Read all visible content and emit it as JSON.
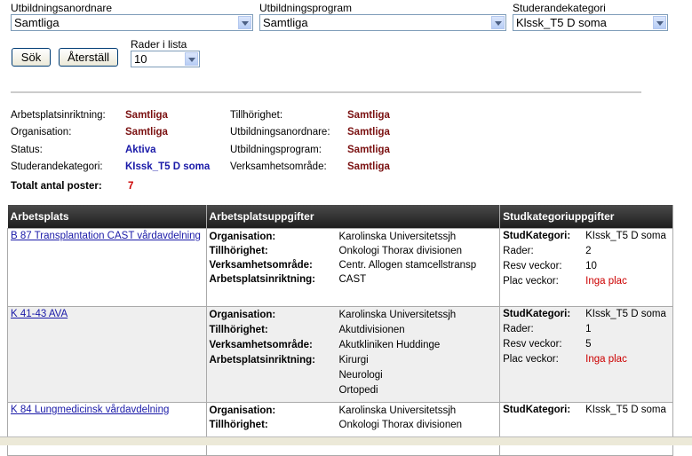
{
  "filters": {
    "utbildningsanordnare": {
      "label": "Utbildningsanordnare",
      "value": "Samtliga"
    },
    "utbildningsprogram": {
      "label": "Utbildningsprogram",
      "value": "Samtliga"
    },
    "studerandekategori": {
      "label": "Studerandekategori",
      "value": "Klssk_T5 D soma"
    },
    "rader": {
      "label": "Rader i lista",
      "value": "10"
    }
  },
  "buttons": {
    "search": "Sök",
    "reset": "Återställ"
  },
  "summary": {
    "left": [
      {
        "label": "Arbetsplatsinriktning:",
        "value": "Samtliga"
      },
      {
        "label": "Organisation:",
        "value": "Samtliga"
      },
      {
        "label": "Status:",
        "value": "Aktiva"
      },
      {
        "label": "Studerandekategori:",
        "value": "KIssk_T5 D soma"
      }
    ],
    "right": [
      {
        "label": "Tillhörighet:",
        "value": "Samtliga"
      },
      {
        "label": "Utbildningsanordnare:",
        "value": "Samtliga"
      },
      {
        "label": "Utbildningsprogram:",
        "value": "Samtliga"
      },
      {
        "label": "Verksamhetsområde:",
        "value": "Samtliga"
      }
    ],
    "total_label": "Totalt antal poster:",
    "total_value": "7"
  },
  "table": {
    "headers": [
      "Arbetsplats",
      "Arbetsplatsuppgifter",
      "Studkategoriuppgifter"
    ],
    "labels": {
      "organisation": "Organisation:",
      "tillhorighet": "Tillhörighet:",
      "verksamhet": "Verksamhetsområde:",
      "inriktning": "Arbetsplatsinriktning:",
      "studkategori": "StudKategori:",
      "rader": "Rader:",
      "resv": "Resv veckor:",
      "plac": "Plac veckor:"
    },
    "rows": [
      {
        "arbetsplats": "B 87 Transplantation CAST vårdavdelning",
        "organisation": "Karolinska Universitetssjh",
        "tillhorighet": "Onkologi Thorax divisionen",
        "verksamhet": "Centr. Allogen stamcellstransp",
        "inriktning": [
          "CAST"
        ],
        "studkategori": "KIssk_T5 D soma",
        "rader": "2",
        "resv": "10",
        "plac": "Inga plac"
      },
      {
        "arbetsplats": "K 41-43 AVA",
        "organisation": "Karolinska Universitetssjh",
        "tillhorighet": "Akutdivisionen",
        "verksamhet": "Akutkliniken Huddinge",
        "inriktning": [
          "Kirurgi",
          "Neurologi",
          "Ortopedi"
        ],
        "studkategori": "KIssk_T5 D soma",
        "rader": "1",
        "resv": "5",
        "plac": "Inga plac"
      },
      {
        "arbetsplats": "K 84 Lungmedicinsk vårdavdelning",
        "organisation": "Karolinska Universitetssjh",
        "tillhorighet": "Onkologi Thorax divisionen",
        "studkategori": "KIssk_T5 D soma"
      }
    ]
  }
}
